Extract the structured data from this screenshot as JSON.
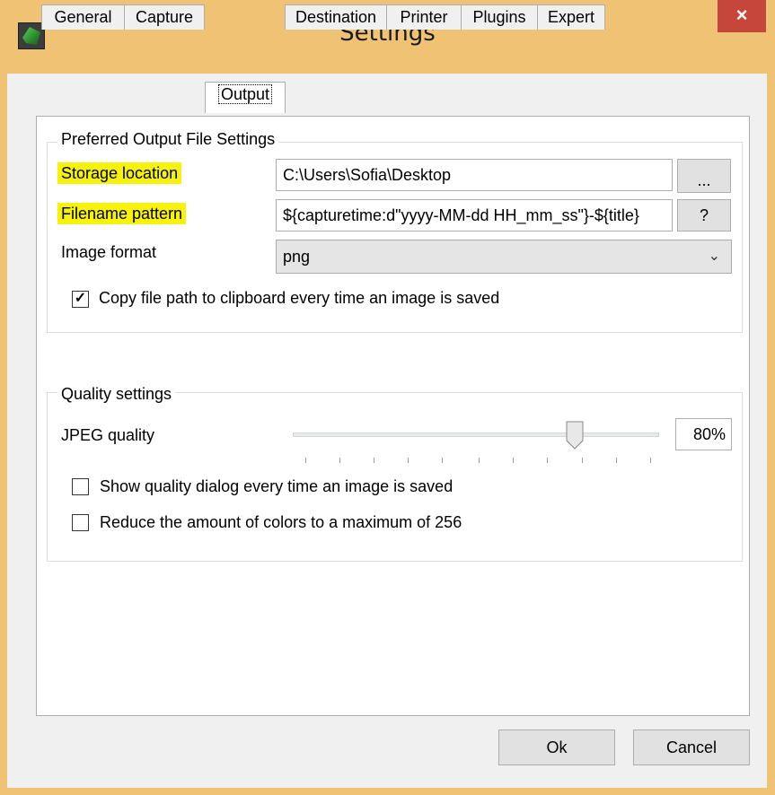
{
  "window": {
    "title": "Settings",
    "close_glyph": "×"
  },
  "tabs": [
    {
      "label": "General"
    },
    {
      "label": "Capture"
    },
    {
      "label": "Output"
    },
    {
      "label": "Destination"
    },
    {
      "label": "Printer"
    },
    {
      "label": "Plugins"
    },
    {
      "label": "Expert"
    }
  ],
  "output_group": {
    "title": "Preferred Output File Settings",
    "storage_label": "Storage location",
    "storage_value": "C:\\Users\\Sofia\\Desktop",
    "browse_label": "...",
    "filename_label": "Filename pattern",
    "filename_value": "${capturetime:d\"yyyy-MM-dd HH_mm_ss\"}-${title}",
    "help_label": "?",
    "format_label": "Image format",
    "format_value": "png",
    "copy_path_label": "Copy file path to clipboard every time an image is saved",
    "copy_path_checked": true
  },
  "quality_group": {
    "title": "Quality settings",
    "jpeg_label": "JPEG quality",
    "jpeg_value": "80%",
    "jpeg_fraction": 0.8,
    "show_dialog_label": "Show quality dialog every time an image is saved",
    "reduce_colors_label": "Reduce the amount of colors to a maximum of 256"
  },
  "buttons": {
    "ok": "Ok",
    "cancel": "Cancel"
  },
  "colors": {
    "highlight": "#f6f20a",
    "title_bar": "#f0c274",
    "close": "#c7463b"
  }
}
